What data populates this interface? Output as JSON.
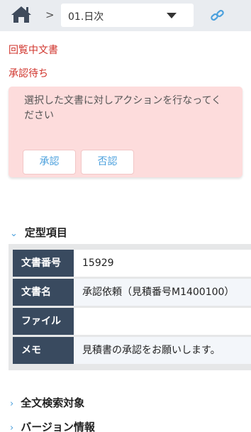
{
  "header": {
    "home_icon": "home-icon",
    "separator": ">",
    "folder_select_value": "01.日次",
    "link_icon": "link-icon"
  },
  "status": {
    "line1": "回覧中文書",
    "line2": "承認待ち"
  },
  "action_panel": {
    "message": "選択した文書に対しアクションを行なってください",
    "approve_label": "承認",
    "reject_label": "否認"
  },
  "sections": {
    "fixed_items_title": "定型項目",
    "fulltext_title": "全文検索対象",
    "version_title": "バージョン情報"
  },
  "fields": [
    {
      "key": "文書番号",
      "value": "15929"
    },
    {
      "key": "文書名",
      "value": "承認依頼（見積番号M1400100）"
    },
    {
      "key": "ファイル",
      "value": ""
    },
    {
      "key": "メモ",
      "value": "見積書の承認をお願いします。"
    }
  ],
  "colors": {
    "accent": "#4ba0dd",
    "status_red": "#d0342c",
    "panel_bg": "#fddcdc",
    "label_bg": "#394a5f"
  }
}
